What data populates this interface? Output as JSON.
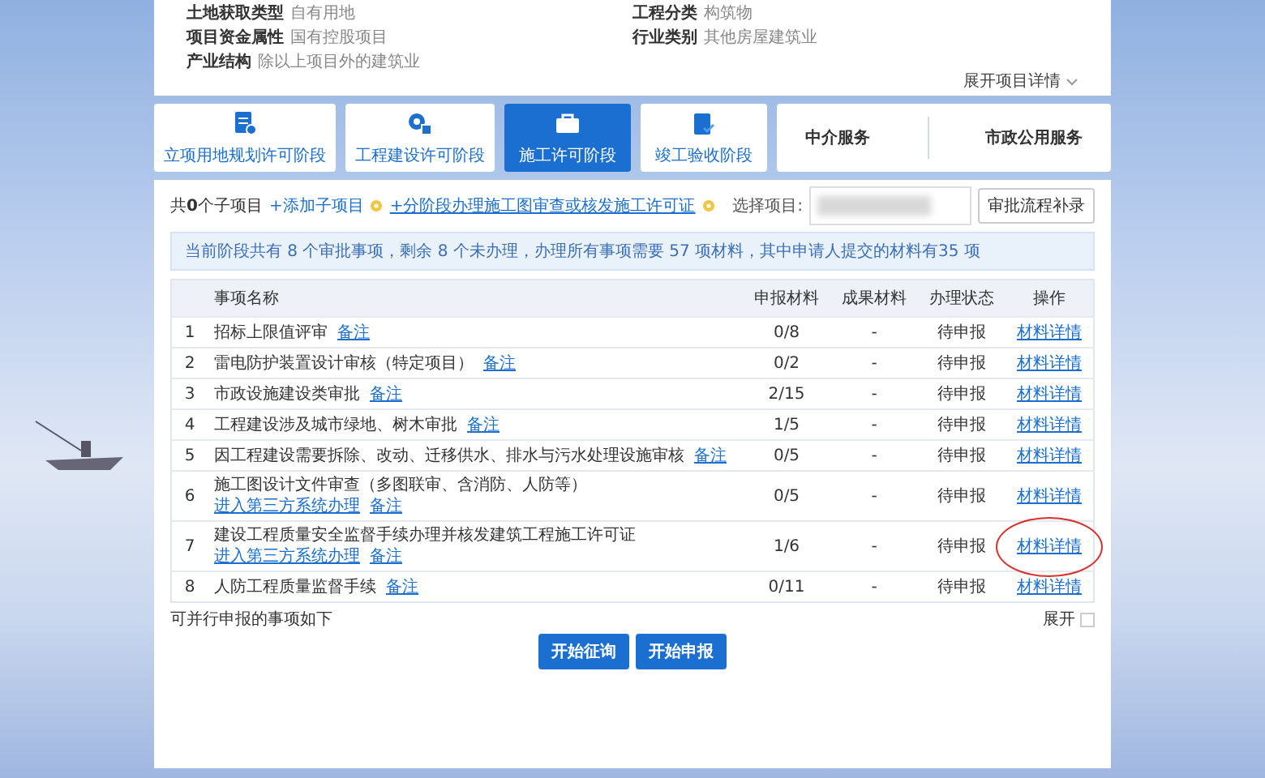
{
  "project_info": {
    "fields": [
      {
        "label": "土地获取类型",
        "value": "自有用地"
      },
      {
        "label": "工程分类",
        "value": "构筑物"
      },
      {
        "label": "项目资金属性",
        "value": "国有控股项目"
      },
      {
        "label": "行业类别",
        "value": "其他房屋建筑业"
      },
      {
        "label": "产业结构",
        "value": "除以上项目外的建筑业"
      }
    ],
    "expand_link": "展开项目详情"
  },
  "stages": [
    {
      "label": "立项用地规划许可阶段",
      "selected": false
    },
    {
      "label": "工程建设许可阶段",
      "selected": false
    },
    {
      "label": "施工许可阶段",
      "selected": true
    },
    {
      "label": "竣工验收阶段",
      "selected": false
    }
  ],
  "services": [
    "中介服务",
    "市政公用服务"
  ],
  "toolbar": {
    "count_text": "共**0**个子项目",
    "links": [
      "+添加子项目",
      "+分阶段办理施工图审查或核发施工许可证"
    ],
    "select_label": "选择项目:",
    "button": "审批流程补录"
  },
  "notice": "当前阶段共有 8 个审批事项，剩余 8 个未办理，办理所有事项需要 57 项材料，其中申请人提交的材料有35 项",
  "table": {
    "columns": [
      "事项名称",
      "申报材料",
      "成果材料",
      "办理状态",
      "操作"
    ],
    "rows": [
      {
        "index": "1",
        "name": "招标上限值评审",
        "links": [
          "备注"
        ],
        "materials": "0/8",
        "results": "-",
        "status": "待申报",
        "action": "材料详情",
        "circled": false
      },
      {
        "index": "2",
        "name": "雷电防护装置设计审核（特定项目）",
        "links": [
          "备注"
        ],
        "materials": "0/2",
        "results": "-",
        "status": "待申报",
        "action": "材料详情",
        "circled": false
      },
      {
        "index": "3",
        "name": "市政设施建设类审批",
        "links": [
          "备注"
        ],
        "materials": "2/15",
        "results": "-",
        "status": "待申报",
        "action": "材料详情",
        "circled": false
      },
      {
        "index": "4",
        "name": "工程建设涉及城市绿地、树木审批",
        "links": [
          "备注"
        ],
        "materials": "1/5",
        "results": "-",
        "status": "待申报",
        "action": "材料详情",
        "circled": false
      },
      {
        "index": "5",
        "name": "因工程建设需要拆除、改动、迁移供水、排水与污水处理设施审核",
        "links": [
          "备注"
        ],
        "materials": "0/5",
        "results": "-",
        "status": "待申报",
        "action": "材料详情",
        "circled": false
      },
      {
        "index": "6",
        "name": "施工图设计文件审查（多图联审、含消防、人防等）",
        "links": [
          "进入第三方系统办理",
          "备注"
        ],
        "materials": "0/5",
        "results": "-",
        "status": "待申报",
        "action": "材料详情",
        "circled": false
      },
      {
        "index": "7",
        "name": "建设工程质量安全监督手续办理并核发建筑工程施工许可证",
        "links": [
          "进入第三方系统办理",
          "备注"
        ],
        "materials": "1/6",
        "results": "-",
        "status": "待申报",
        "action": "材料详情",
        "circled": true
      },
      {
        "index": "8",
        "name": "人防工程质量监督手续",
        "links": [
          "备注"
        ],
        "materials": "0/11",
        "results": "-",
        "status": "待申报",
        "action": "材料详情",
        "circled": false
      }
    ]
  },
  "footer": {
    "text": "可并行申报的事项如下",
    "expand": "展开"
  },
  "buttons": [
    "开始征询",
    "开始申报"
  ]
}
